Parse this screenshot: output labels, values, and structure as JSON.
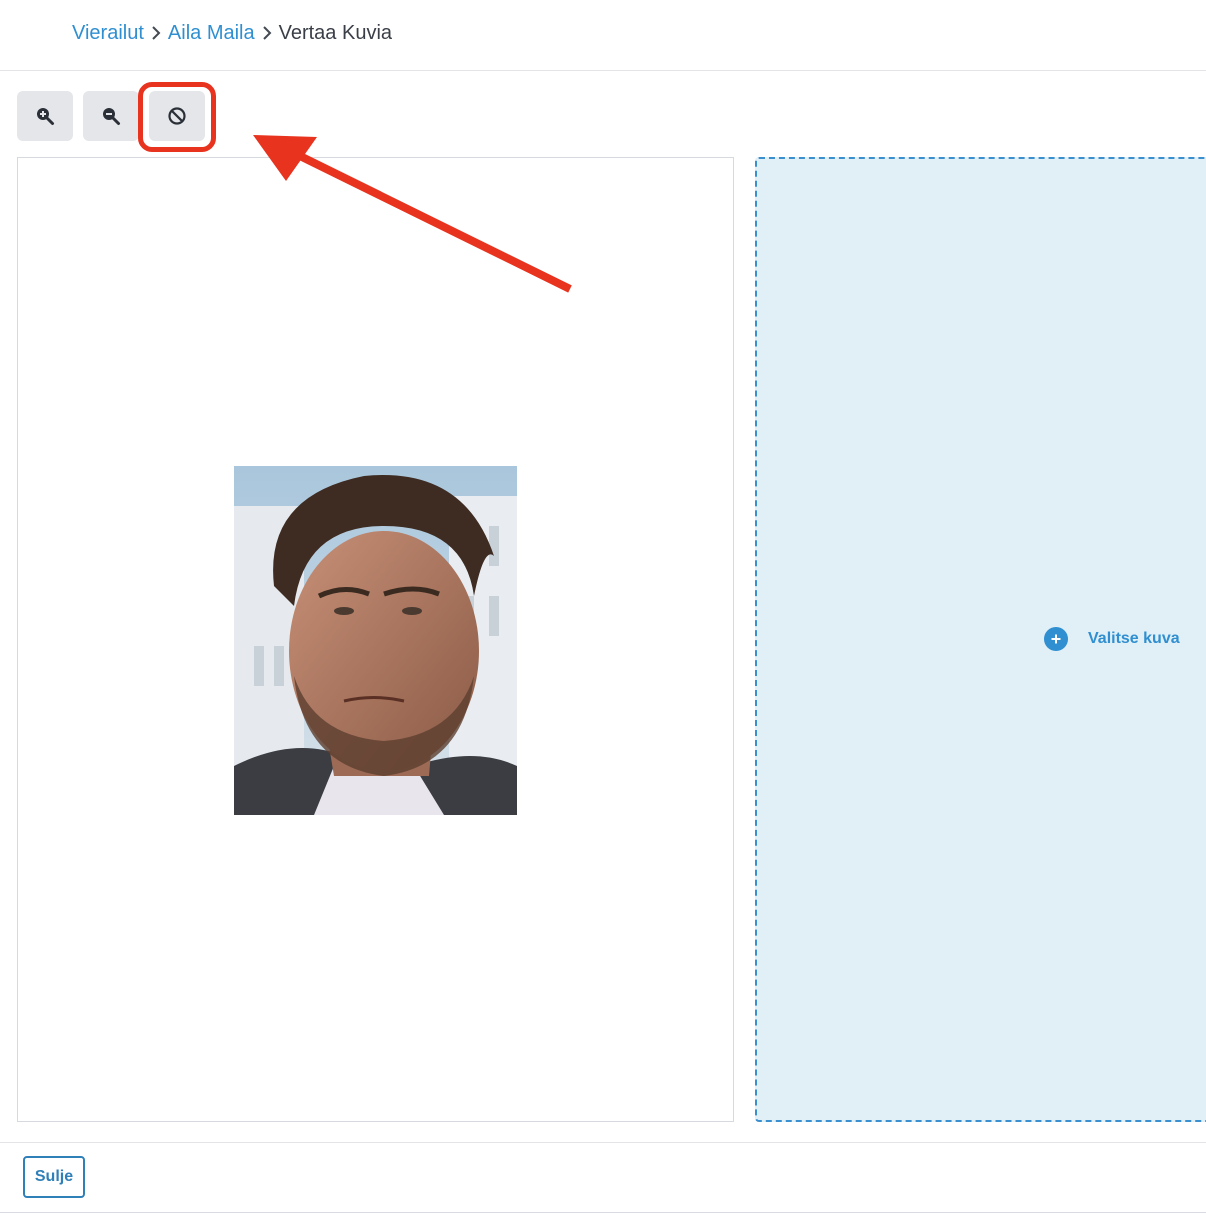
{
  "breadcrumb": {
    "items": [
      {
        "label": "Vierailut"
      },
      {
        "label": "Aila Maila"
      },
      {
        "label": "Vertaa Kuvia"
      }
    ]
  },
  "toolbar": {
    "zoom_in_icon": "zoom-in-icon",
    "zoom_out_icon": "zoom-out-icon",
    "reset_icon": "ban-icon"
  },
  "right_panel": {
    "choose_label": "Valitse kuva",
    "icon": "plus-circle-icon"
  },
  "footer": {
    "close_label": "Sulje"
  },
  "colors": {
    "accent": "#2f8fd0",
    "annotation": "#e8331f",
    "dropzone_bg": "#e1eff7"
  }
}
